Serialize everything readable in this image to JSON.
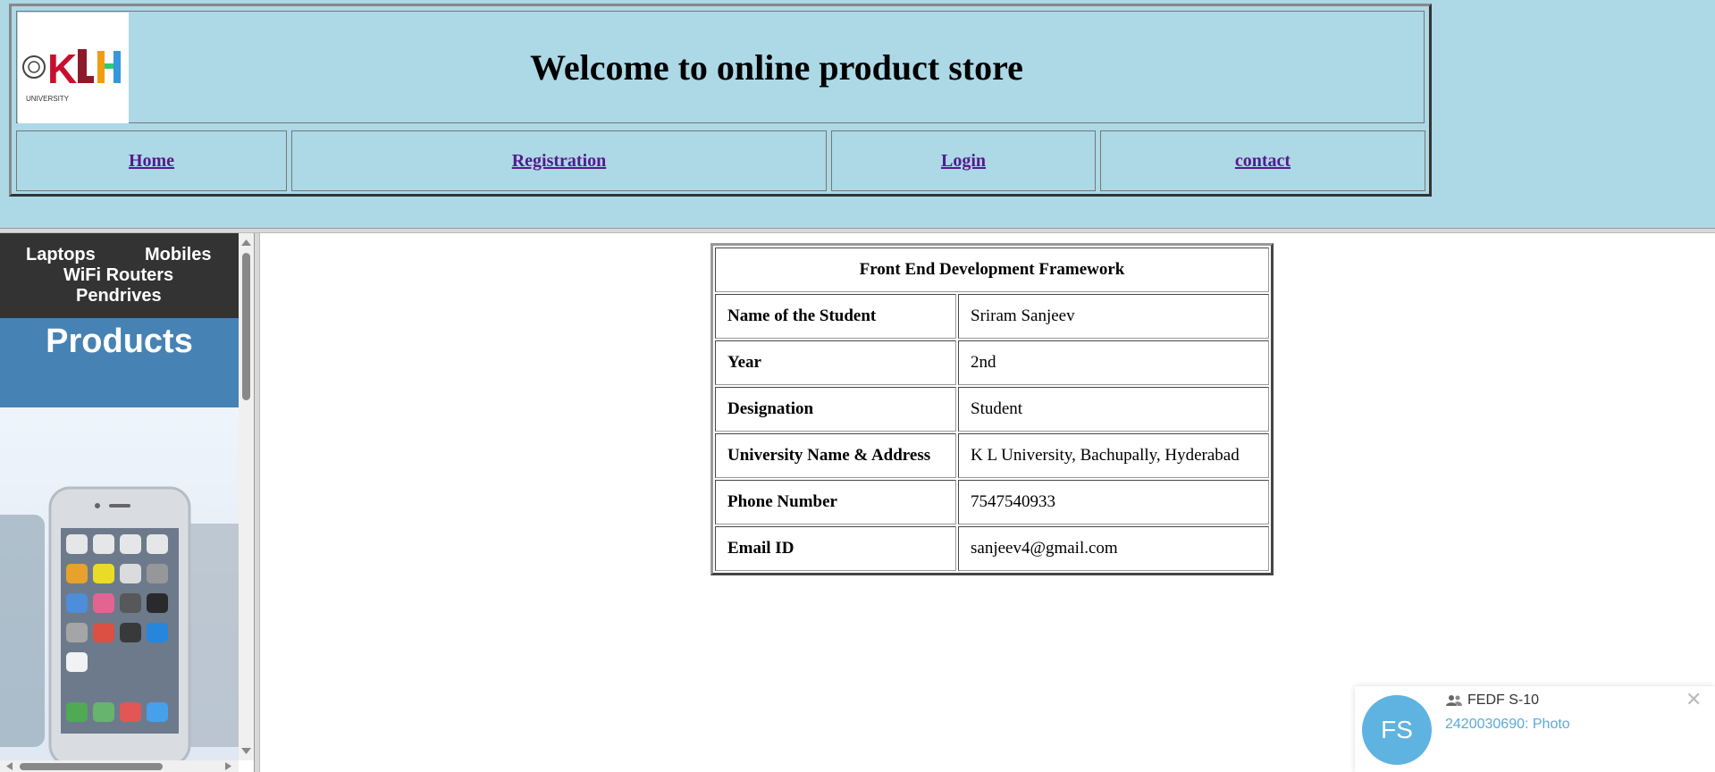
{
  "header": {
    "title": "Welcome to online product store",
    "logo_text": "KLH",
    "logo_subtext": "UNIVERSITY",
    "nav": [
      {
        "label": "Home"
      },
      {
        "label": "Registration"
      },
      {
        "label": "Login"
      },
      {
        "label": "contact"
      }
    ]
  },
  "sidebar": {
    "links": [
      "Laptops",
      "Mobiles",
      "WiFi Routers",
      "Pendrives"
    ],
    "banner": "Products",
    "image_icon": "phones-image"
  },
  "details": {
    "heading": "Front End Development Framework",
    "rows": [
      {
        "label": "Name of the Student",
        "value": "Sriram Sanjeev"
      },
      {
        "label": "Year",
        "value": "2nd"
      },
      {
        "label": "Designation",
        "value": "Student"
      },
      {
        "label": "University Name & Address",
        "value": "K L University, Bachupally, Hyderabad"
      },
      {
        "label": "Phone Number",
        "value": "7547540933"
      },
      {
        "label": "Email ID",
        "value": "sanjeev4@gmail.com"
      }
    ]
  },
  "notification": {
    "avatar_initials": "FS",
    "group_name": "FEDF S-10",
    "message": "2420030690: Photo",
    "group_icon": "group-icon",
    "close_icon": "close-icon",
    "avatar_color": "#5fb3e0"
  },
  "colors": {
    "header_bg": "#add8e6",
    "side_menu_bg": "#333333",
    "products_banner_bg": "#4682b4",
    "link_color": "#551a8b"
  }
}
